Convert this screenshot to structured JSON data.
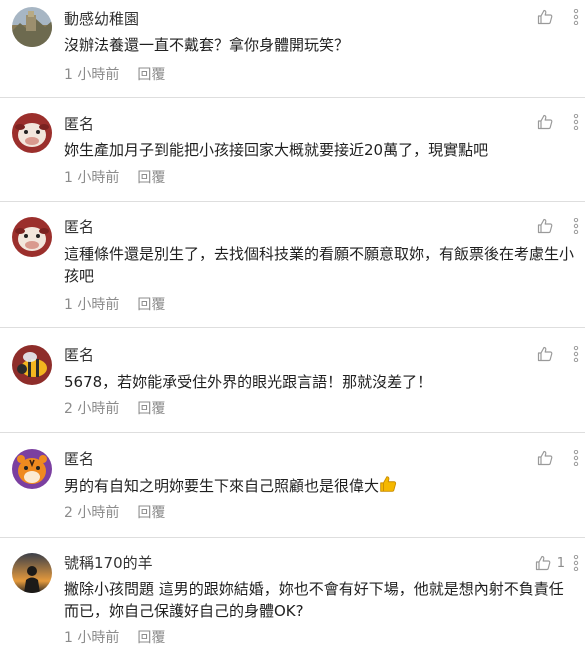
{
  "reply_label": "回覆",
  "comments": [
    {
      "author": "動感幼稚園",
      "text": "沒辦法養還一直不戴套？拿你身體開玩笑？",
      "time": "1 小時前",
      "avatar_icon": "landscape-avatar-icon"
    },
    {
      "author": "匿名",
      "text": "妳生產加月子到能把小孩接回家大概就要接近20萬了，現實點吧",
      "time": "1 小時前",
      "avatar_icon": "cow-avatar-icon"
    },
    {
      "author": "匿名",
      "text": "這種條件還是別生了，去找個科技業的看願不願意取妳，有飯票後在考慮生小孩吧",
      "time": "1 小時前",
      "avatar_icon": "cow-avatar-icon"
    },
    {
      "author": "匿名",
      "text": "5678，若妳能承受住外界的眼光跟言語！那就沒差了！",
      "time": "2 小時前",
      "avatar_icon": "bee-avatar-icon"
    },
    {
      "author": "匿名",
      "text": "男的有自知之明妳要生下來自己照顧也是很偉大",
      "time": "2 小時前",
      "avatar_icon": "tiger-avatar-icon",
      "emoji_icon": "thumbs-up-emoji-icon"
    },
    {
      "author": "號稱170的羊",
      "text": "撇除小孩問題 這男的跟妳結婚，妳也不會有好下場，他就是想內射不負責任而已，妳自己保護好自己的身體OK?",
      "time": "1 小時前",
      "avatar_icon": "silhouette-avatar-icon",
      "like_count": "1"
    }
  ],
  "colors": {
    "meta": "#8c8c8c",
    "divider": "#dedede",
    "emoji": "#f5b800"
  }
}
